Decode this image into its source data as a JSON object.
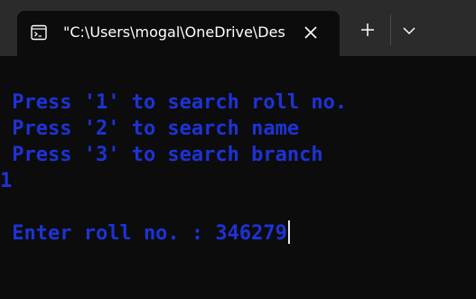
{
  "tab": {
    "icon": "terminal-icon",
    "title": "\"C:\\Users\\mogal\\OneDrive\\Desktop\\"
  },
  "titlebar": {
    "close_icon": "close-icon",
    "new_tab_icon": "plus-icon",
    "dropdown_icon": "chevron-down-icon"
  },
  "terminal": {
    "lines": [
      " Press '1' to search roll no.",
      " Press '2' to search name",
      " Press '3' to search branch",
      "1",
      "",
      " Enter roll no. : 346279"
    ]
  },
  "colors": {
    "titlebar_bg": "#2b2b2b",
    "terminal_bg": "#0c0c0c",
    "text": "#1d33d6"
  }
}
